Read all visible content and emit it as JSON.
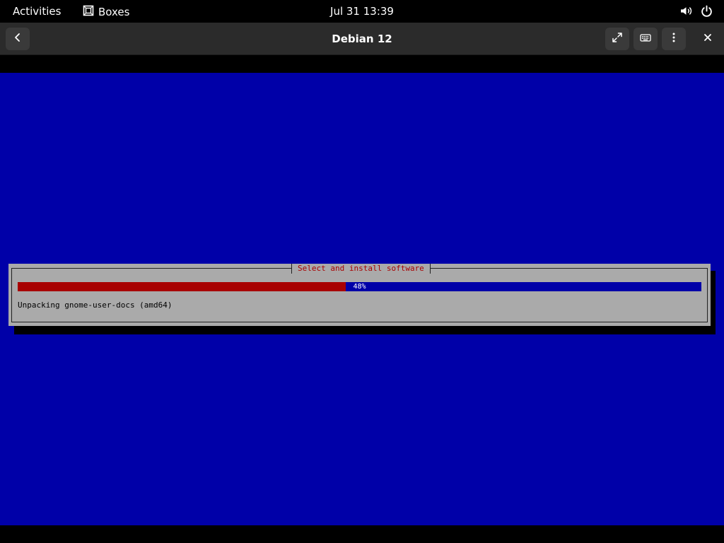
{
  "topbar": {
    "activities_label": "Activities",
    "app_name": "Boxes",
    "app_icon": "boxes-icon",
    "datetime": "Jul 31  13:39",
    "tray_icons": [
      "volume-icon",
      "power-icon"
    ]
  },
  "headerbar": {
    "title": "Debian 12",
    "back_icon": "chevron-left-icon",
    "fullscreen_icon": "fullscreen-icon",
    "keyboard_icon": "keyboard-icon",
    "menu_icon": "kebab-menu-icon",
    "close_label": "✕"
  },
  "installer": {
    "dialog_title": "Select and install software",
    "progress_percent": 48,
    "progress_label": "48%",
    "status": "Unpacking gnome-user-docs (amd64)",
    "colors": {
      "background": "#0000a8",
      "dialog": "#aaaaaa",
      "title": "#a80000",
      "progress_fill": "#a80000",
      "progress_track": "#0000a8"
    }
  }
}
